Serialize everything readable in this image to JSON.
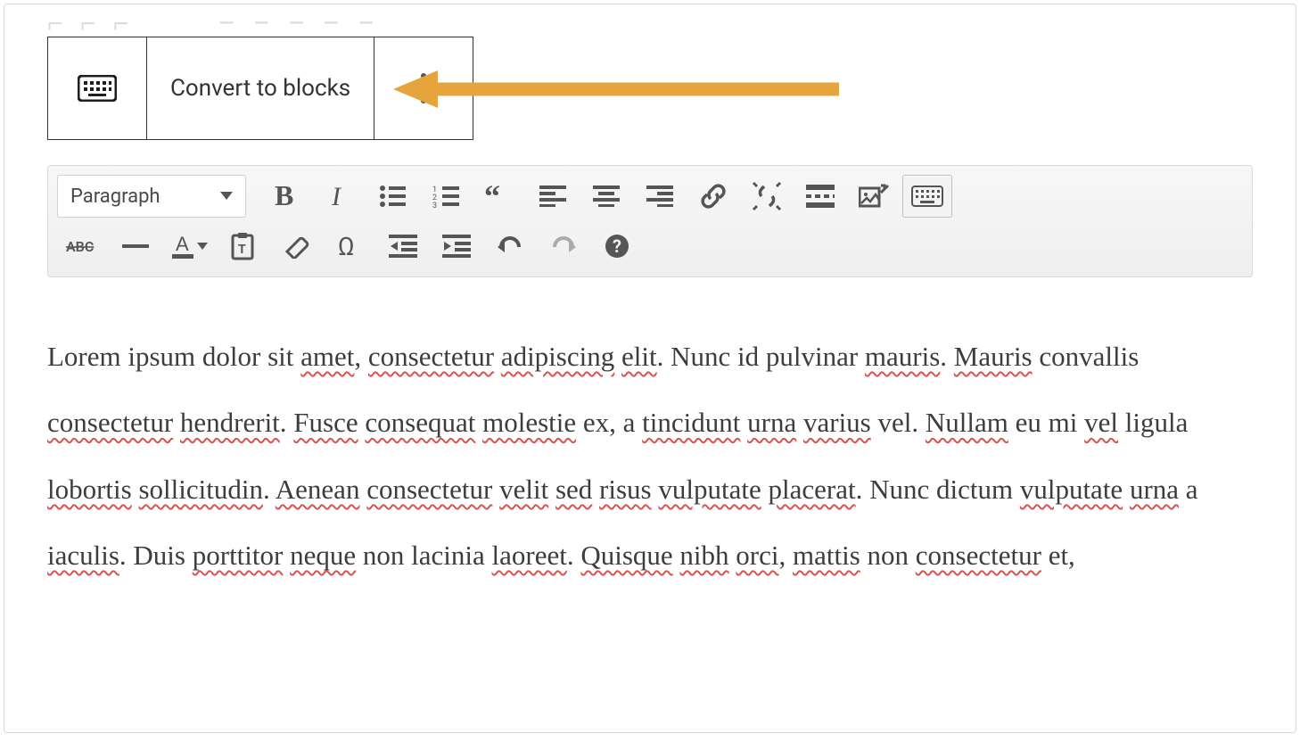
{
  "blockToolbar": {
    "convertLabel": "Convert to blocks"
  },
  "formatSelect": {
    "value": "Paragraph"
  },
  "content": {
    "segments": [
      {
        "t": "Lorem ipsum dolor sit ",
        "sp": false
      },
      {
        "t": "amet",
        "sp": true
      },
      {
        "t": ", ",
        "sp": false
      },
      {
        "t": "consectetur",
        "sp": true
      },
      {
        "t": " ",
        "sp": false
      },
      {
        "t": "adipiscing",
        "sp": true
      },
      {
        "t": " ",
        "sp": false
      },
      {
        "t": "elit",
        "sp": true
      },
      {
        "t": ". Nunc id pulvinar ",
        "sp": false
      },
      {
        "t": "mauris",
        "sp": true
      },
      {
        "t": ". ",
        "sp": false
      },
      {
        "t": "Mauris",
        "sp": true
      },
      {
        "t": " convallis ",
        "sp": false
      },
      {
        "t": "consectetur",
        "sp": true
      },
      {
        "t": " ",
        "sp": false
      },
      {
        "t": "hendrerit",
        "sp": true
      },
      {
        "t": ". ",
        "sp": false
      },
      {
        "t": "Fusce",
        "sp": true
      },
      {
        "t": " ",
        "sp": false
      },
      {
        "t": "consequat",
        "sp": true
      },
      {
        "t": " ",
        "sp": false
      },
      {
        "t": "molestie",
        "sp": true
      },
      {
        "t": " ex, a ",
        "sp": false
      },
      {
        "t": "tincidunt",
        "sp": true
      },
      {
        "t": " ",
        "sp": false
      },
      {
        "t": "urna",
        "sp": true
      },
      {
        "t": " ",
        "sp": false
      },
      {
        "t": "varius",
        "sp": true
      },
      {
        "t": " vel. ",
        "sp": false
      },
      {
        "t": "Nullam",
        "sp": true
      },
      {
        "t": " eu mi ",
        "sp": false
      },
      {
        "t": "vel",
        "sp": true
      },
      {
        "t": " ligula ",
        "sp": false
      },
      {
        "t": "lobortis",
        "sp": true
      },
      {
        "t": " ",
        "sp": false
      },
      {
        "t": "sollicitudin",
        "sp": true
      },
      {
        "t": ". ",
        "sp": false
      },
      {
        "t": "Aenean",
        "sp": true
      },
      {
        "t": " ",
        "sp": false
      },
      {
        "t": "consectetur",
        "sp": true
      },
      {
        "t": " ",
        "sp": false
      },
      {
        "t": "velit",
        "sp": true
      },
      {
        "t": " ",
        "sp": false
      },
      {
        "t": "sed",
        "sp": true
      },
      {
        "t": " ",
        "sp": false
      },
      {
        "t": "risus",
        "sp": true
      },
      {
        "t": " ",
        "sp": false
      },
      {
        "t": "vulputate",
        "sp": true
      },
      {
        "t": " ",
        "sp": false
      },
      {
        "t": "placerat",
        "sp": true
      },
      {
        "t": ". Nunc dictum ",
        "sp": false
      },
      {
        "t": "vulputate",
        "sp": true
      },
      {
        "t": " ",
        "sp": false
      },
      {
        "t": "urna",
        "sp": true
      },
      {
        "t": " a ",
        "sp": false
      },
      {
        "t": "iaculis",
        "sp": true
      },
      {
        "t": ". Duis ",
        "sp": false
      },
      {
        "t": "porttitor",
        "sp": true
      },
      {
        "t": " ",
        "sp": false
      },
      {
        "t": "neque",
        "sp": true
      },
      {
        "t": " non lacinia ",
        "sp": false
      },
      {
        "t": "laoreet",
        "sp": true
      },
      {
        "t": ". ",
        "sp": false
      },
      {
        "t": "Quisque",
        "sp": true
      },
      {
        "t": " ",
        "sp": false
      },
      {
        "t": "nibh",
        "sp": true
      },
      {
        "t": " ",
        "sp": false
      },
      {
        "t": "orci",
        "sp": true
      },
      {
        "t": ", ",
        "sp": false
      },
      {
        "t": "mattis",
        "sp": true
      },
      {
        "t": " non ",
        "sp": false
      },
      {
        "t": "consectetur",
        "sp": true
      },
      {
        "t": " et,",
        "sp": false
      }
    ]
  },
  "colors": {
    "arrow": "#e6a43c"
  }
}
